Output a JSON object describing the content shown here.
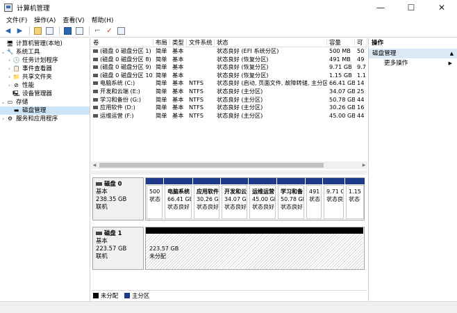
{
  "window": {
    "title": "计算机管理",
    "min": "—",
    "max": "☐",
    "close": "✕"
  },
  "menu": [
    "文件(F)",
    "操作(A)",
    "查看(V)",
    "帮助(H)"
  ],
  "tree": {
    "root": "计算机管理(本地)",
    "system_tools": "系统工具",
    "task_scheduler": "任务计划程序",
    "event_viewer": "事件查看器",
    "shared_folders": "共享文件夹",
    "performance": "性能",
    "device_manager": "设备管理器",
    "storage": "存储",
    "disk_management": "磁盘管理",
    "services_apps": "服务和应用程序"
  },
  "list": {
    "headers": [
      "卷",
      "布局",
      "类型",
      "文件系统",
      "状态",
      "容量",
      "可"
    ],
    "rows": [
      [
        "(磁盘 0 磁盘分区 1)",
        "简单",
        "基本",
        "",
        "状态良好 (EFI 系统分区)",
        "500 MB",
        "50"
      ],
      [
        "(磁盘 0 磁盘分区 8)",
        "简单",
        "基本",
        "",
        "状态良好 (恢复分区)",
        "491 MB",
        "49"
      ],
      [
        "(磁盘 0 磁盘分区 9)",
        "简单",
        "基本",
        "",
        "状态良好 (恢复分区)",
        "9.71 GB",
        "9.7"
      ],
      [
        "(磁盘 0 磁盘分区 10)",
        "简单",
        "基本",
        "",
        "状态良好 (恢复分区)",
        "1.15 GB",
        "1.1"
      ],
      [
        "电脑系统 (C:)",
        "简单",
        "基本",
        "NTFS",
        "状态良好 (启动, 页面文件, 故障转储, 主分区)",
        "66.41 GB",
        "14"
      ],
      [
        "开发和云端 (E:)",
        "简单",
        "基本",
        "NTFS",
        "状态良好 (主分区)",
        "34.07 GB",
        "25"
      ],
      [
        "学习和备份 (G:)",
        "简单",
        "基本",
        "NTFS",
        "状态良好 (主分区)",
        "50.78 GB",
        "44"
      ],
      [
        "应用软件 (D:)",
        "简单",
        "基本",
        "NTFS",
        "状态良好 (主分区)",
        "30.26 GB",
        "16"
      ],
      [
        "运维运营 (F:)",
        "简单",
        "基本",
        "NTFS",
        "状态良好 (主分区)",
        "45.00 GB",
        "44"
      ]
    ]
  },
  "disks": [
    {
      "name": "磁盘 0",
      "type": "基本",
      "size": "238.35 GB",
      "status": "联机",
      "partitions": [
        {
          "name": "",
          "size": "500",
          "status": "状态"
        },
        {
          "name": "电脑系统",
          "size": "66.41 GE",
          "status": "状态良好"
        },
        {
          "name": "应用软件",
          "size": "30.26 G",
          "status": "状态良好"
        },
        {
          "name": "开发和云",
          "size": "34.07 G",
          "status": "状态良好"
        },
        {
          "name": "运维运营",
          "size": "45.00 GE",
          "status": "状态良好"
        },
        {
          "name": "学习和备",
          "size": "50.78 GE",
          "status": "状态良好"
        },
        {
          "name": "",
          "size": "491",
          "status": "状态"
        },
        {
          "name": "",
          "size": "9.71 G",
          "status": "状态良"
        },
        {
          "name": "",
          "size": "1.15 (",
          "status": "状态"
        }
      ]
    },
    {
      "name": "磁盘 1",
      "type": "基本",
      "size": "223.57 GB",
      "status": "联机",
      "partitions": [
        {
          "name": "",
          "size": "223.57 GB",
          "status": "未分配"
        }
      ]
    }
  ],
  "legend": [
    {
      "label": "未分配",
      "color": "#000000"
    },
    {
      "label": "主分区",
      "color": "#1e3a8a"
    }
  ],
  "actions": {
    "header": "操作",
    "section": "磁盘管理",
    "more": "更多操作"
  }
}
